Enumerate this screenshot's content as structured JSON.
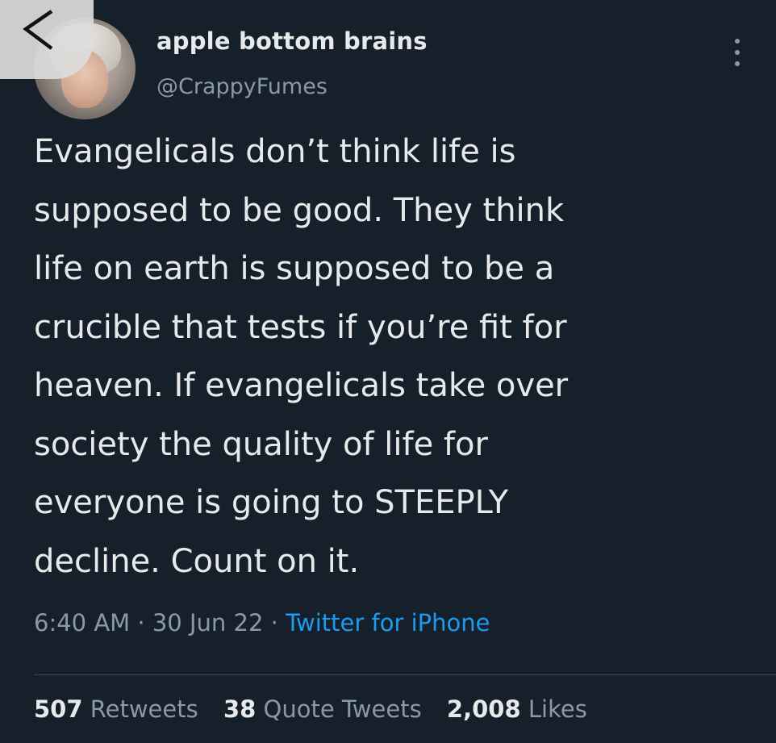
{
  "tweet": {
    "author": {
      "display_name": "apple bottom brains",
      "handle": "@CrappyFumes"
    },
    "text_lines": [
      "Evangelicals don’t think life is",
      "supposed to be good. They think",
      "life on earth is supposed to be a",
      "crucible that tests if you’re fit for",
      "heaven. If evangelicals take over",
      "society the quality of life for",
      "everyone is going to STEEPLY",
      "decline. Count on it."
    ],
    "time": "6:40 AM",
    "date": "30 Jun 22",
    "separator": "·",
    "source": "Twitter for iPhone",
    "stats": {
      "retweets_count": "507",
      "retweets_label": "Retweets",
      "quote_tweets_count": "38",
      "quote_tweets_label": "Quote Tweets",
      "likes_count": "2,008",
      "likes_label": "Likes"
    }
  },
  "icons": {
    "back": "chevron-left-icon",
    "more": "more-vertical-icon"
  },
  "colors": {
    "background": "#15202b",
    "text": "#e7e9ea",
    "muted": "#8b98a5",
    "link": "#1d9bf0"
  }
}
